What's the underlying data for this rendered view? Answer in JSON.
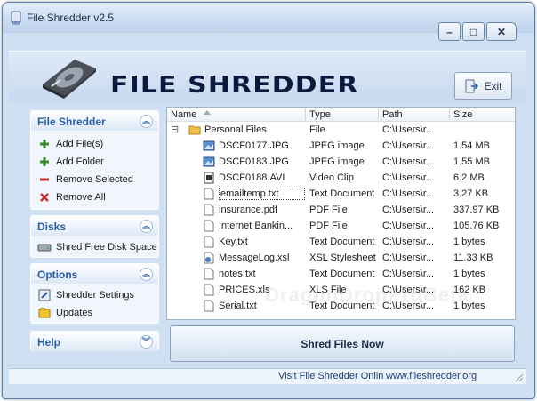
{
  "window": {
    "title": "File Shredder v2.5"
  },
  "titlebar_buttons": {
    "minimize": "–",
    "maximize": "□",
    "close": "✕"
  },
  "header": {
    "logo_text": "FILE SHREDDER",
    "exit_label": "Exit"
  },
  "sidebar": {
    "file_shredder": {
      "title": "File Shredder",
      "items": [
        {
          "label": "Add File(s)",
          "icon": "plus-icon"
        },
        {
          "label": "Add Folder",
          "icon": "plus-icon"
        },
        {
          "label": "Remove Selected",
          "icon": "minus-icon"
        },
        {
          "label": "Remove All",
          "icon": "x-icon"
        }
      ]
    },
    "disks": {
      "title": "Disks",
      "items": [
        {
          "label": "Shred Free Disk Space",
          "icon": "disk-icon"
        }
      ]
    },
    "options": {
      "title": "Options",
      "items": [
        {
          "label": "Shredder Settings",
          "icon": "settings-icon"
        },
        {
          "label": "Updates",
          "icon": "updates-icon"
        }
      ]
    },
    "help": {
      "title": "Help"
    }
  },
  "file_list": {
    "columns": [
      "Name",
      "Type",
      "Path",
      "Size"
    ],
    "rows": [
      {
        "name": "Personal Files",
        "type": "File",
        "path": "C:\\Users\\r...",
        "size": "",
        "icon": "folder-icon"
      },
      {
        "name": "DSCF0177.JPG",
        "type": "JPEG image",
        "path": "C:\\Users\\r...",
        "size": "1.54 MB",
        "icon": "image-file-icon"
      },
      {
        "name": "DSCF0183.JPG",
        "type": "JPEG image",
        "path": "C:\\Users\\r...",
        "size": "1.55 MB",
        "icon": "image-file-icon"
      },
      {
        "name": "DSCF0188.AVI",
        "type": "Video Clip",
        "path": "C:\\Users\\r...",
        "size": "6.2 MB",
        "icon": "video-file-icon"
      },
      {
        "name": "emailtemp.txt",
        "type": "Text Document",
        "path": "C:\\Users\\r...",
        "size": "3.27 KB",
        "icon": "text-file-icon"
      },
      {
        "name": "insurance.pdf",
        "type": "PDF File",
        "path": "C:\\Users\\r...",
        "size": "337.97 KB",
        "icon": "blank-file-icon"
      },
      {
        "name": "Internet Bankin...",
        "type": "PDF File",
        "path": "C:\\Users\\r...",
        "size": "105.76 KB",
        "icon": "blank-file-icon"
      },
      {
        "name": "Key.txt",
        "type": "Text Document",
        "path": "C:\\Users\\r...",
        "size": "1 bytes",
        "icon": "blank-file-icon"
      },
      {
        "name": "MessageLog.xsl",
        "type": "XSL Stylesheet",
        "path": "C:\\Users\\r...",
        "size": "11.33 KB",
        "icon": "xsl-file-icon"
      },
      {
        "name": "notes.txt",
        "type": "Text Document",
        "path": "C:\\Users\\r...",
        "size": "1 bytes",
        "icon": "blank-file-icon"
      },
      {
        "name": "PRICES.xls",
        "type": "XLS File",
        "path": "C:\\Users\\r...",
        "size": "162 KB",
        "icon": "blank-file-icon"
      },
      {
        "name": "Serial.txt",
        "type": "Text Document",
        "path": "C:\\Users\\r...",
        "size": "1 bytes",
        "icon": "blank-file-icon"
      }
    ],
    "folder_toggle": "⊟",
    "watermark": "DragonDropProBeta"
  },
  "actions": {
    "shred_label": "Shred Files Now"
  },
  "status": {
    "link1": "Visit File Shredder Onlin",
    "link2": "www.fileshredder.org"
  },
  "colors": {
    "accent": "#2a5da8",
    "window_bg": "#cfe0f2"
  }
}
